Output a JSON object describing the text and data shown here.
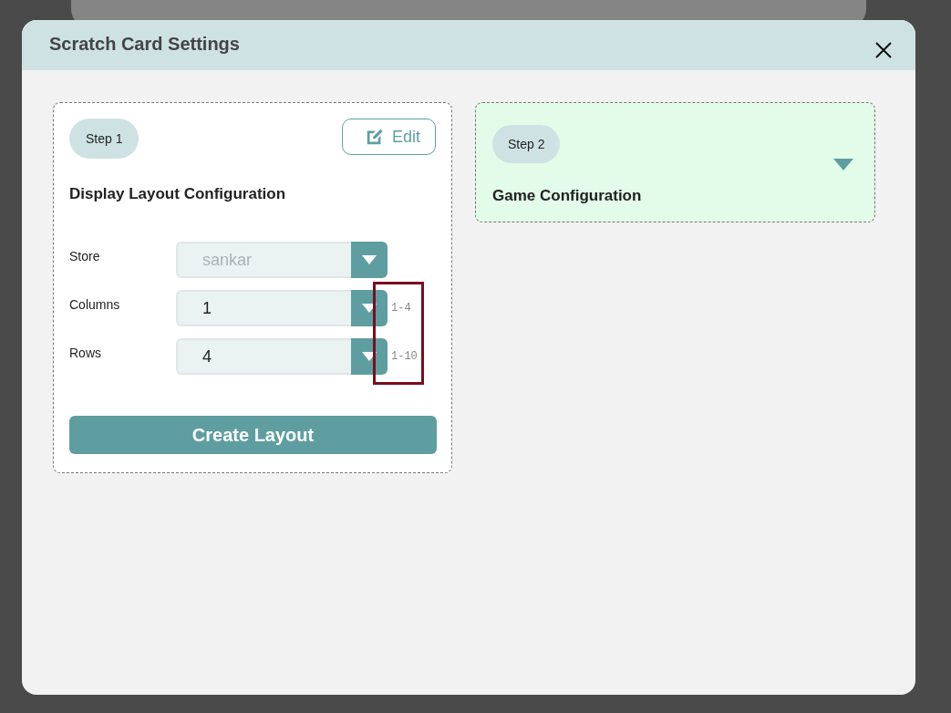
{
  "dialog": {
    "title": "Scratch Card Settings"
  },
  "step_1": {
    "badge": "Step 1",
    "title": "Display Layout Configuration",
    "edit_button": "Edit",
    "fields": [
      {
        "label": "Store",
        "value": "sankar",
        "disabled": true
      },
      {
        "label": "Columns",
        "value": "1",
        "disabled": false,
        "hint": "1-4"
      },
      {
        "label": "Rows",
        "value": "4",
        "disabled": false,
        "hint": "1-10"
      }
    ],
    "submit_button": "Create Layout"
  },
  "step_2": {
    "badge": "Step 2",
    "title": "Game Configuration",
    "expanded": false
  }
}
